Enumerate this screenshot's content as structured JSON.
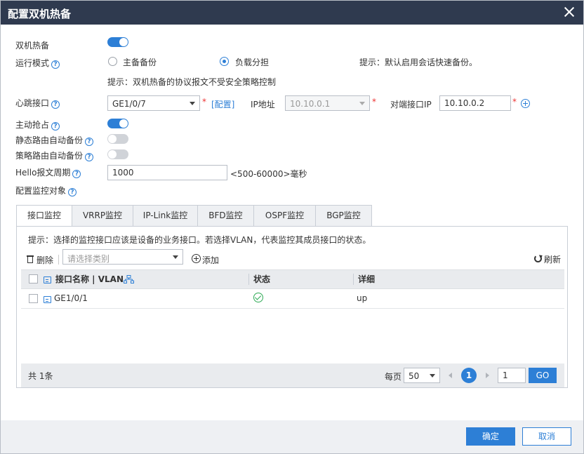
{
  "dialog": {
    "title": "配置双机热备"
  },
  "form": {
    "hot_standby_label": "双机热备",
    "hot_standby_on": true,
    "run_mode_label": "运行模式",
    "run_mode_options": [
      "主备备份",
      "负载分担"
    ],
    "run_mode_selected": "负载分担",
    "run_mode_hint": "提示：默认启用会话快速备份。",
    "policy_hint": "提示：双机热备的协议报文不受安全策略控制",
    "heartbeat_label": "心跳接口",
    "heartbeat_value": "GE1/0/7",
    "configure_link": "[配置]",
    "ip_label": "IP地址",
    "ip_value": "10.10.0.1",
    "peer_ip_label": "对端接口IP",
    "peer_ip_value": "10.10.0.2",
    "preempt_label": "主动抢占",
    "preempt_on": true,
    "static_route_label": "静态路由自动备份",
    "static_route_on": false,
    "policy_route_label": "策略路由自动备份",
    "policy_route_on": false,
    "hello_label": "Hello报文周期",
    "hello_value": "1000",
    "hello_range": "<500-60000>毫秒",
    "monitor_label": "配置监控对象"
  },
  "tabs": [
    "接口监控",
    "VRRP监控",
    "IP-Link监控",
    "BFD监控",
    "OSPF监控",
    "BGP监控"
  ],
  "active_tab": "接口监控",
  "panel": {
    "hint": "提示：选择的监控接口应该是设备的业务接口。若选择VLAN，代表监控其成员接口的状态。",
    "delete_label": "删除",
    "category_placeholder": "请选择类别",
    "add_label": "添加",
    "refresh_label": "刷新"
  },
  "table": {
    "headers": [
      "接口名称 | VLAN",
      "状态",
      "详细"
    ],
    "rows": [
      {
        "name": "GE1/0/1",
        "status": "ok",
        "detail": "up"
      }
    ]
  },
  "pager": {
    "total": "共 1条",
    "per_page_label": "每页",
    "per_page_value": "50",
    "current_page": "1",
    "page_input": "1",
    "go_label": "GO"
  },
  "footer": {
    "ok_label": "确定",
    "cancel_label": "取消"
  },
  "colors": {
    "titlebar": "#2f3a4f",
    "accent": "#2d7fd6",
    "required": "#e33333",
    "status_ok": "#2eaa55"
  },
  "icons": {
    "help": "question-circle-icon",
    "add": "plus-circle-icon",
    "delete": "trash-icon",
    "refresh": "refresh-icon",
    "interface": "interface-icon",
    "vlan": "vlan-topology-icon",
    "status_ok": "check-circle-icon",
    "close": "close-icon"
  }
}
